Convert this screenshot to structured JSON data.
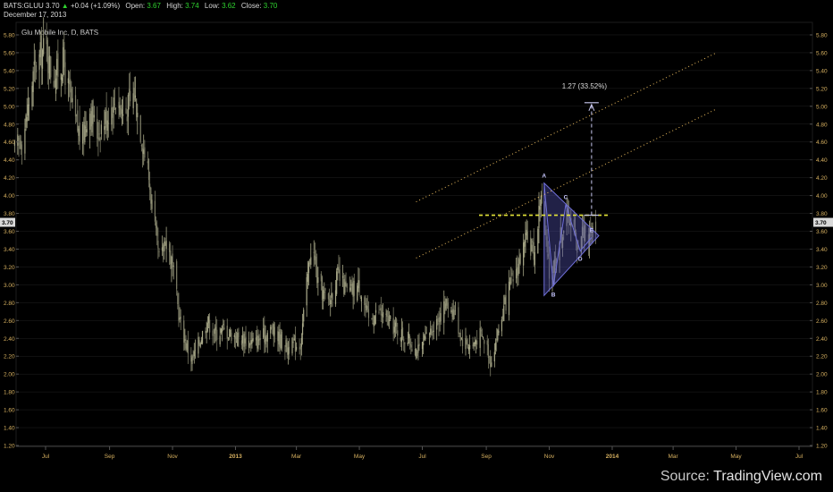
{
  "header": {
    "symbol": "BATS:GLUU",
    "last": "3.70",
    "change_arrow": "▲",
    "change": "+0.04 (+1.09%)",
    "open_label": "Open:",
    "open": "3.67",
    "high_label": "High:",
    "high": "3.74",
    "low_label": "Low:",
    "low": "3.62",
    "close_label": "Close:",
    "close": "3.70",
    "date": "December 17, 2013"
  },
  "source": {
    "prefix": "Source: ",
    "brand": "TradingView.com"
  },
  "colors": {
    "background": "#000000",
    "candle": "#9a9a7c",
    "axis_text": "#d6b060",
    "grid_line": "#222222",
    "last_price_tag": "#d9d9d9",
    "resistance": "#e8e83a",
    "channel": "#f0c060",
    "triangle_fill": "#4a4a9e",
    "triangle_stroke": "#7070d8",
    "target": "#c8c8f0",
    "change_up": "#2fd22f"
  },
  "chart_data": {
    "type": "candlestick",
    "title": "Glu Mobile Inc, D, BATS",
    "ylim": [
      1.2,
      5.85
    ],
    "y_ticks": [
      "1.20",
      "1.40",
      "1.60",
      "1.80",
      "2.00",
      "2.20",
      "2.40",
      "2.60",
      "2.80",
      "3.00",
      "3.20",
      "3.40",
      "3.60",
      "3.80",
      "4.00",
      "4.20",
      "4.40",
      "4.60",
      "4.80",
      "5.00",
      "5.20",
      "5.40",
      "5.60",
      "5.80"
    ],
    "x_ticks": [
      {
        "label": "Jul",
        "date": "2012-07-01",
        "bold": false
      },
      {
        "label": "Sep",
        "date": "2012-09-01",
        "bold": false
      },
      {
        "label": "Nov",
        "date": "2012-11-01",
        "bold": false
      },
      {
        "label": "2013",
        "date": "2013-01-01",
        "bold": true
      },
      {
        "label": "Mar",
        "date": "2013-03-01",
        "bold": false
      },
      {
        "label": "May",
        "date": "2013-05-01",
        "bold": false
      },
      {
        "label": "Jul",
        "date": "2013-07-01",
        "bold": false
      },
      {
        "label": "Sep",
        "date": "2013-09-01",
        "bold": false
      },
      {
        "label": "Nov",
        "date": "2013-11-01",
        "bold": false
      },
      {
        "label": "2014",
        "date": "2014-01-01",
        "bold": true
      },
      {
        "label": "Mar",
        "date": "2014-03-01",
        "bold": false
      },
      {
        "label": "May",
        "date": "2014-05-01",
        "bold": false
      },
      {
        "label": "Jul",
        "date": "2014-07-01",
        "bold": false
      }
    ],
    "last_price": "3.70",
    "price_path": [
      [
        "2012-06-01",
        4.5
      ],
      [
        "2012-06-10",
        4.7
      ],
      [
        "2012-06-20",
        5.4
      ],
      [
        "2012-07-01",
        5.7
      ],
      [
        "2012-07-08",
        5.3
      ],
      [
        "2012-07-18",
        5.5
      ],
      [
        "2012-07-28",
        4.9
      ],
      [
        "2012-08-05",
        4.6
      ],
      [
        "2012-08-12",
        5.0
      ],
      [
        "2012-08-20",
        4.7
      ],
      [
        "2012-09-01",
        4.95
      ],
      [
        "2012-09-08",
        5.1
      ],
      [
        "2012-09-15",
        4.9
      ],
      [
        "2012-09-25",
        5.15
      ],
      [
        "2012-10-03",
        4.6
      ],
      [
        "2012-10-08",
        4.3
      ],
      [
        "2012-10-15",
        3.6
      ],
      [
        "2012-10-20",
        3.2
      ],
      [
        "2012-10-25",
        3.55
      ],
      [
        "2012-11-01",
        3.2
      ],
      [
        "2012-11-08",
        2.6
      ],
      [
        "2012-11-15",
        2.3
      ],
      [
        "2012-11-20",
        2.15
      ],
      [
        "2012-11-28",
        2.4
      ],
      [
        "2012-12-05",
        2.6
      ],
      [
        "2012-12-12",
        2.45
      ],
      [
        "2012-12-20",
        2.5
      ],
      [
        "2013-01-05",
        2.4
      ],
      [
        "2013-01-20",
        2.35
      ],
      [
        "2013-02-05",
        2.5
      ],
      [
        "2013-02-20",
        2.3
      ],
      [
        "2013-03-05",
        2.35
      ],
      [
        "2013-03-12",
        3.1
      ],
      [
        "2013-03-16",
        3.5
      ],
      [
        "2013-03-22",
        3.0
      ],
      [
        "2013-04-01",
        2.8
      ],
      [
        "2013-04-10",
        3.1
      ],
      [
        "2013-04-20",
        2.9
      ],
      [
        "2013-05-01",
        3.0
      ],
      [
        "2013-05-10",
        2.6
      ],
      [
        "2013-05-20",
        2.7
      ],
      [
        "2013-06-01",
        2.55
      ],
      [
        "2013-06-15",
        2.4
      ],
      [
        "2013-06-28",
        2.25
      ],
      [
        "2013-07-05",
        2.4
      ],
      [
        "2013-07-15",
        2.6
      ],
      [
        "2013-07-25",
        2.8
      ],
      [
        "2013-08-01",
        2.7
      ],
      [
        "2013-08-08",
        2.4
      ],
      [
        "2013-08-18",
        2.3
      ],
      [
        "2013-08-25",
        2.45
      ],
      [
        "2013-09-01",
        2.35
      ],
      [
        "2013-09-05",
        2.15
      ],
      [
        "2013-09-12",
        2.45
      ],
      [
        "2013-09-22",
        2.9
      ],
      [
        "2013-10-01",
        3.2
      ],
      [
        "2013-10-10",
        3.5
      ],
      [
        "2013-10-18",
        3.35
      ],
      [
        "2013-10-24",
        4.05
      ],
      [
        "2013-10-28",
        3.55
      ],
      [
        "2013-11-01",
        3.1
      ],
      [
        "2013-11-05",
        3.2
      ],
      [
        "2013-11-12",
        3.55
      ],
      [
        "2013-11-20",
        3.8
      ],
      [
        "2013-11-28",
        3.45
      ],
      [
        "2013-12-05",
        3.65
      ],
      [
        "2013-12-10",
        3.5
      ],
      [
        "2013-12-17",
        3.7
      ]
    ],
    "trend_lines": [
      {
        "name": "resistance",
        "style": "dashed",
        "from": [
          "2013-08-25",
          3.78
        ],
        "to": [
          "2013-12-28",
          3.78
        ]
      },
      {
        "name": "channel-upper",
        "style": "dotted",
        "from": [
          "2013-06-25",
          3.93
        ],
        "to": [
          "2014-04-12",
          5.6
        ]
      },
      {
        "name": "channel-lower",
        "style": "dotted",
        "from": [
          "2013-06-25",
          3.3
        ],
        "to": [
          "2014-04-12",
          4.97
        ]
      }
    ],
    "pattern": {
      "type": "ABCDE triangle",
      "points": [
        {
          "label": "A",
          "date": "2013-10-27",
          "value": 4.14
        },
        {
          "label": "B",
          "date": "2013-11-05",
          "value": 2.98
        },
        {
          "label": "C",
          "date": "2013-11-17",
          "value": 3.9
        },
        {
          "label": "D",
          "date": "2013-12-01",
          "value": 3.38
        },
        {
          "label": "E",
          "date": "2013-12-12",
          "value": 3.53
        }
      ],
      "outline": [
        [
          "2013-10-27",
          4.14
        ],
        [
          "2013-12-19",
          3.55
        ],
        [
          "2013-10-27",
          2.88
        ]
      ]
    },
    "target": {
      "label": "1.27 (33.52%)",
      "date": "2013-12-12",
      "from": 3.78,
      "to": 5.04
    }
  }
}
